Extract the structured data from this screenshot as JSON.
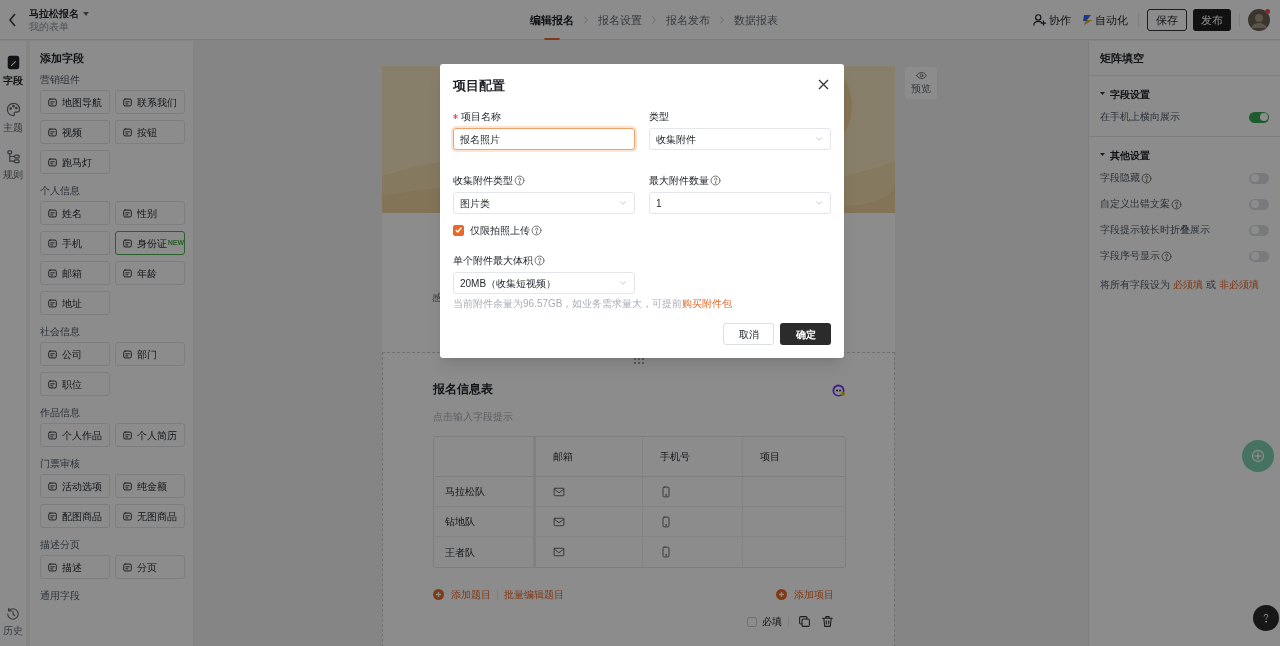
{
  "header": {
    "title": "马拉松报名",
    "subtitle": "我的表单",
    "steps": [
      {
        "label": "编辑报名",
        "selected": true
      },
      {
        "label": "报名设置",
        "selected": false
      },
      {
        "label": "报名发布",
        "selected": false
      },
      {
        "label": "数据报表",
        "selected": false
      }
    ],
    "actions": [
      {
        "kind": "collab",
        "label": "协作"
      },
      {
        "kind": "auto",
        "label": "自动化"
      },
      {
        "kind": "save",
        "label": "保存"
      },
      {
        "kind": "publish",
        "label": "发布"
      }
    ]
  },
  "rail": {
    "items": [
      {
        "label": "字段",
        "selected": true
      },
      {
        "label": "主题",
        "selected": false
      },
      {
        "label": "规则",
        "selected": false
      }
    ],
    "bottom": "历史"
  },
  "sidebar": {
    "title": "添加字段",
    "groups": [
      {
        "title": "营销组件",
        "items": [
          {
            "label": "地图导航"
          },
          {
            "label": "联系我们"
          },
          {
            "label": "视频"
          },
          {
            "label": "按钮"
          },
          {
            "label": "跑马灯"
          }
        ]
      },
      {
        "title": "个人信息",
        "items": [
          {
            "label": "姓名"
          },
          {
            "label": "性别"
          },
          {
            "label": "手机"
          },
          {
            "label": "身份证",
            "badge": "NEW"
          },
          {
            "label": "邮箱"
          },
          {
            "label": "年龄"
          },
          {
            "label": "地址"
          }
        ]
      },
      {
        "title": "社会信息",
        "items": [
          {
            "label": "公司"
          },
          {
            "label": "部门"
          },
          {
            "label": "职位"
          }
        ]
      },
      {
        "title": "作品信息",
        "items": [
          {
            "label": "个人作品"
          },
          {
            "label": "个人简历"
          }
        ]
      },
      {
        "title": "门票审核",
        "items": [
          {
            "label": "活动选项"
          },
          {
            "label": "纯金额"
          },
          {
            "label": "配图商品"
          },
          {
            "label": "无图商品"
          }
        ]
      },
      {
        "title": "描述分页",
        "items": [
          {
            "label": "描述"
          },
          {
            "label": "分页"
          }
        ]
      },
      {
        "title": "通用字段"
      }
    ]
  },
  "canvas": {
    "preview": "预览",
    "partial_text": "感",
    "section": {
      "title": "报名信息表",
      "hint": "点击输入字段提示",
      "table": {
        "columns": [
          "邮箱",
          "手机号",
          "项目"
        ],
        "rows": [
          {
            "label": "马拉松队",
            "cells": [
              {
                "kind": "email"
              },
              {
                "kind": "phone"
              }
            ]
          },
          {
            "label": "钻地队",
            "cells": [
              {
                "kind": "email"
              },
              {
                "kind": "phone"
              }
            ]
          },
          {
            "label": "王者队",
            "cells": [
              {
                "kind": "email"
              },
              {
                "kind": "phone"
              }
            ]
          }
        ]
      },
      "add_question": "添加题目",
      "batch_edit": "批量编辑题目",
      "add_item": "添加项目",
      "required": {
        "label": "必填",
        "checked": false
      }
    }
  },
  "right_panel": {
    "title": "矩阵填空",
    "sections": [
      {
        "title": "字段设置",
        "expanded": true,
        "settings": [
          {
            "label": "在手机上横向展示",
            "help": false,
            "on": true
          }
        ]
      },
      {
        "title": "其他设置",
        "expanded": true,
        "settings": [
          {
            "label": "字段隐藏",
            "help": true,
            "on": false
          },
          {
            "label": "自定义出错文案",
            "help": true,
            "on": false
          },
          {
            "label": "字段提示较长时折叠展示",
            "help": false,
            "on": false
          },
          {
            "label": "字段序号显示",
            "help": true,
            "on": false
          }
        ]
      }
    ],
    "note": {
      "prefix": "将所有字段设为",
      "link_1": "必须填",
      "middle": "或",
      "link_2": "非必须填"
    }
  },
  "modal": {
    "title": "项目配置",
    "name": {
      "label": "项目名称",
      "required": true,
      "value": "报名照片"
    },
    "type": {
      "label": "类型",
      "value": "收集附件"
    },
    "attach_type": {
      "label": "收集附件类型",
      "value": "图片类"
    },
    "max_count": {
      "label": "最大附件数量",
      "value": "1"
    },
    "camera_only": {
      "label": "仅限拍照上传",
      "checked": true
    },
    "max_size": {
      "label": "单个附件最大体积",
      "value": "20MB（收集短视频）"
    },
    "quota": {
      "text": "当前附件余量为96.57GB，如业务需求量大，可提前",
      "link": "购买附件包"
    },
    "buttons": [
      {
        "kind": "cancel",
        "label": "取消"
      },
      {
        "kind": "ok",
        "label": "确定"
      }
    ]
  }
}
